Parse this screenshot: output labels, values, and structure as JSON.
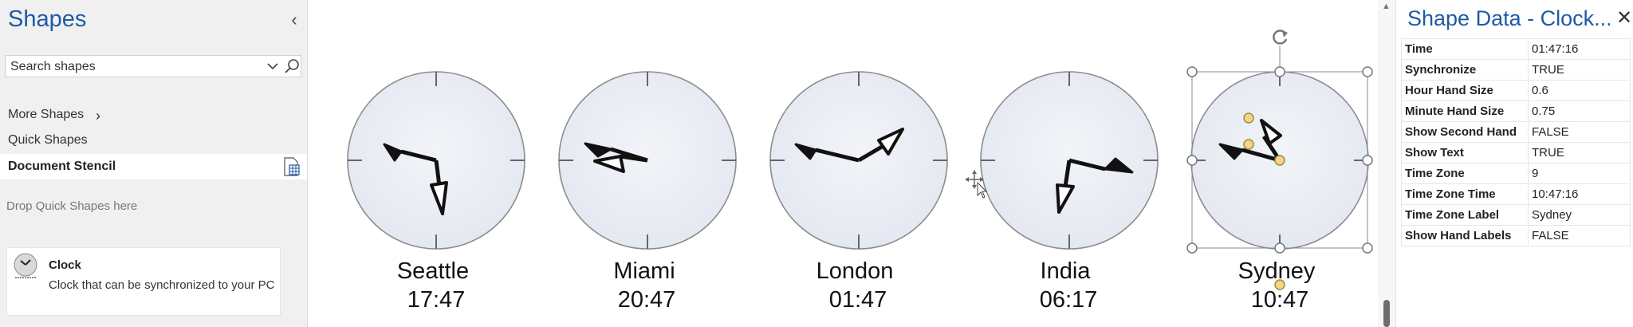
{
  "shapes_pane": {
    "title": "Shapes",
    "search_placeholder": "Search shapes",
    "more_shapes": "More Shapes",
    "quick_shapes": "Quick Shapes",
    "document_stencil": "Document Stencil",
    "drop_hint": "Drop Quick Shapes here",
    "master": {
      "name": "Clock",
      "description": "Clock that can be synchronized to your PC"
    }
  },
  "clocks": [
    {
      "label": "Seattle",
      "time": "17:47"
    },
    {
      "label": "Miami",
      "time": "20:47"
    },
    {
      "label": "London",
      "time": "01:47"
    },
    {
      "label": "India",
      "time": "06:17"
    },
    {
      "label": "Sydney",
      "time": "10:47"
    }
  ],
  "shape_data": {
    "title": "Shape Data - Clock...",
    "rows": [
      {
        "key": "Time",
        "value": "01:47:16"
      },
      {
        "key": "Synchronize",
        "value": "TRUE"
      },
      {
        "key": "Hour Hand Size",
        "value": "0.6"
      },
      {
        "key": "Minute Hand Size",
        "value": "0.75"
      },
      {
        "key": "Show Second Hand",
        "value": "FALSE"
      },
      {
        "key": "Show Text",
        "value": "TRUE"
      },
      {
        "key": "Time Zone",
        "value": "9"
      },
      {
        "key": "Time Zone Time",
        "value": "10:47:16"
      },
      {
        "key": "Time Zone Label",
        "value": "Sydney"
      },
      {
        "key": "Show Hand Labels",
        "value": "FALSE"
      }
    ]
  },
  "colors": {
    "accent": "#1f5aa6",
    "clock_face": "#e9edf5",
    "pane_bg": "#f0f0f0",
    "handle_yellow": "#f3d77a"
  },
  "icons": {
    "collapse": "chevron-left-icon",
    "search": "search-icon",
    "close": "close-icon",
    "rotate": "rotate-handle-icon",
    "move": "move-cursor-icon"
  }
}
